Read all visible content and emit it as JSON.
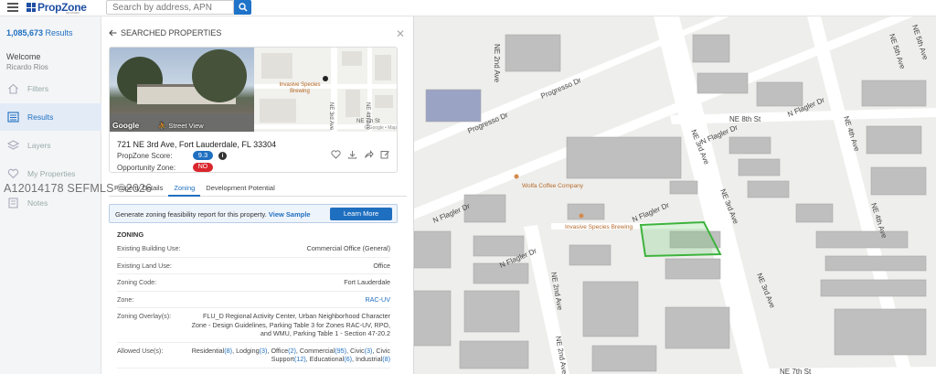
{
  "app": {
    "logo_text": "PropZone",
    "logo_sub": "NETWORK"
  },
  "search": {
    "placeholder": "Search by address, APN"
  },
  "sidebar": {
    "result_count": "1,085,673",
    "result_suffix": " Results",
    "welcome": "Welcome",
    "username": "Ricardo Rios",
    "items": [
      {
        "label": "Filters",
        "icon": "home-icon"
      },
      {
        "label": "Results",
        "icon": "list-icon"
      },
      {
        "label": "Layers",
        "icon": "layers-icon"
      },
      {
        "label": "My Properties",
        "icon": "heart-icon"
      },
      {
        "label": "Notes",
        "icon": "notes-icon"
      }
    ]
  },
  "watermark": "A12014178  SEFMLS ©2026",
  "panel": {
    "title": "SEARCHED PROPERTIES",
    "street_view_label": "Street View",
    "google": "Google",
    "minimap": {
      "poi": "Invasive Species Brewing",
      "street_1": "NE 3rd Ave",
      "street_2": "NE 4th Ave",
      "street_3": "NE 7th St",
      "credit": "© Google • Map"
    },
    "address": "721 NE 3rd Ave, Fort Lauderdale, FL 33304",
    "score_label": "PropZone Score:",
    "score_value": "9.3",
    "opportunity_label": "Opportunity Zone:",
    "opportunity_value": "NO",
    "tabs": [
      {
        "label": "Property Details"
      },
      {
        "label": "Zoning"
      },
      {
        "label": "Development Potential"
      }
    ],
    "banner": {
      "text": "Generate zoning feasibility report for this property.",
      "link": "View Sample",
      "button": "Learn More"
    },
    "zoning_title": "ZONING",
    "rows": [
      {
        "label": "Existing Building Use:",
        "value": "Commercial Office (General)"
      },
      {
        "label": "Existing Land Use:",
        "value": "Office"
      },
      {
        "label": "Zoning Code:",
        "value": "Fort Lauderdale"
      },
      {
        "label": "Zone:",
        "value": "RAC-UV"
      },
      {
        "label": "Zoning Overlay(s):",
        "value": "FLU_D Regional Activity Center, Urban Neighborhood Character Zone - Design Guidelines, Parking Table 3 for Zones RAC-UV, RPO, and WMU, Parking Table 1 - Section 47-20.2"
      },
      {
        "label": "Allowed Use(s):",
        "value_parts": [
          [
            "Residential",
            "(8)",
            ", "
          ],
          [
            "Lodging",
            "(3)",
            ", "
          ],
          [
            "Office",
            "(2)",
            ", "
          ],
          [
            "Commercial",
            "(95)",
            ", "
          ],
          [
            "Civic",
            "(3)",
            ", "
          ],
          [
            "Civic Support",
            "(12)",
            ", "
          ],
          [
            "Educational",
            "(6)",
            ", "
          ],
          [
            "Industrial",
            "(8)",
            ""
          ]
        ]
      }
    ]
  },
  "map": {
    "labels": [
      "N Flagler Dr",
      "N Flagler Dr",
      "N Flagler Dr",
      "N Flagler Dr",
      "N Flagler Dr",
      "Progresso Dr",
      "Progresso Dr",
      "NE 8th St",
      "NE 7th St",
      "NE 3rd Ave",
      "NE 3rd Ave",
      "NE 3rd Ave",
      "NE 2nd Ave",
      "NE 2nd Ave",
      "NE 2nd Ave",
      "NE 4th Ave",
      "NE 4th Ave",
      "NE 5th Ave",
      "NE 5th Ave"
    ],
    "poi": [
      "Wolfa Coffee Company",
      "Invasive Species Brewing"
    ],
    "selected_parcel_color": "#3db33d",
    "accent": "#1f6fc0"
  }
}
